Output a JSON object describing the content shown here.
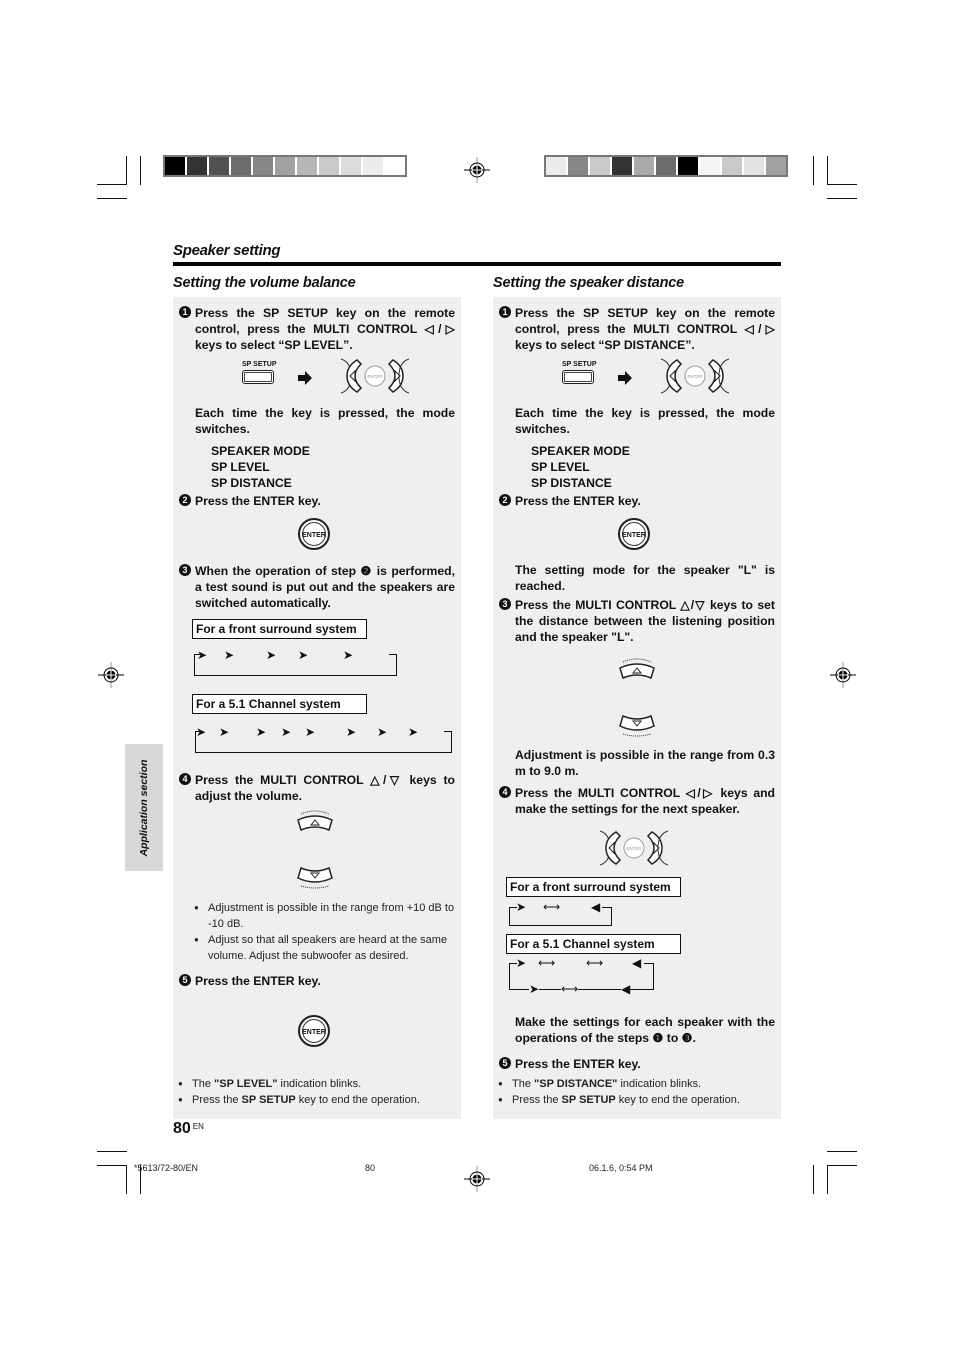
{
  "section_title": "Speaker setting",
  "side_tab": "Application section",
  "page": {
    "number": "80",
    "lang": "EN"
  },
  "footer": {
    "code": "*5613/72-80/EN",
    "page": "80",
    "timestamp": "06.1.6, 0:54 PM"
  },
  "color_bar_left": [
    "#000000",
    "#333333",
    "#515151",
    "#6c6c6c",
    "#878787",
    "#a1a1a1",
    "#b6b6b6",
    "#c9c9c9",
    "#dcdcdc",
    "#ececec",
    "#ffffff"
  ],
  "color_bar_right": [
    "#ececec",
    "#878787",
    "#c9c9c9",
    "#333333",
    "#aaaaaa",
    "#6c6c6c",
    "#000000",
    "#f5f5f5",
    "#c9c9c9",
    "#e2e2e2",
    "#a1a1a1"
  ],
  "labels": {
    "sp_setup": "SP SETUP",
    "enter": "ENTER",
    "multi_control": "MULTI CONTROL"
  },
  "left": {
    "title": "Setting the volume balance",
    "step1": {
      "num": "1",
      "text": "Press the SP SETUP key on the remote control, press the MULTI CONTROL ◁/▷ keys to select “SP LEVEL”."
    },
    "each_time": "Each time the key is pressed, the mode switches.",
    "modes": [
      "SPEAKER MODE",
      "SP LEVEL",
      "SP DISTANCE"
    ],
    "step2": {
      "num": "2",
      "text": "Press the ENTER key."
    },
    "step3": {
      "num": "3",
      "text": "When the operation of step ❷ is performed, a test sound is put out and the speakers are switched automatically."
    },
    "front_surround_label": "For a front surround system",
    "channel51_label": "For a 5.1 Channel system",
    "step4": {
      "num": "4",
      "text": "Press the MULTI CONTROL △/▽ keys to adjust the volume."
    },
    "bullets4": [
      "Adjustment is possible in the range from +10 dB to -10 dB.",
      "Adjust so that all speakers are heard at the same volume. Adjust the subwoofer as desired."
    ],
    "step5": {
      "num": "5",
      "text": "Press the ENTER key."
    },
    "bullets5": [
      {
        "pre": "The ",
        "bold": "\"SP LEVEL\"",
        "post": " indication blinks."
      },
      {
        "pre": "Press the ",
        "bold": "SP SETUP",
        "post": " key to end the operation."
      }
    ]
  },
  "right": {
    "title": "Setting the speaker distance",
    "step1": {
      "num": "1",
      "text": "Press the SP SETUP key on the remote control, press the MULTI CONTROL ◁/▷ keys to select “SP DISTANCE”."
    },
    "each_time": "Each time the key is pressed, the mode switches.",
    "modes": [
      "SPEAKER MODE",
      "SP LEVEL",
      "SP DISTANCE"
    ],
    "step2": {
      "num": "2",
      "text": "Press the ENTER key."
    },
    "reached": "The setting mode for the speaker \"L\" is reached.",
    "step3": {
      "num": "3",
      "text": "Press the MULTI CONTROL △/▽ keys to set the distance between the listening position and the speaker \"L\"."
    },
    "range": "Adjustment is possible in the range from 0.3 m to 9.0 m.",
    "step4": {
      "num": "4",
      "text": "Press the MULTI CONTROL ◁/▷ keys and make the settings for the next speaker."
    },
    "front_surround_label": "For a front surround system",
    "channel51_label": "For a 5.1 Channel system",
    "make_settings": "Make the settings for each speaker with the operations of the steps ❶ to ❸.",
    "step5": {
      "num": "5",
      "text": "Press the ENTER key."
    },
    "bullets5": [
      {
        "pre": "The ",
        "bold": "\"SP DISTANCE\"",
        "post": " indication blinks."
      },
      {
        "pre": "Press the ",
        "bold": "SP SETUP",
        "post": " key to end the operation."
      }
    ]
  }
}
